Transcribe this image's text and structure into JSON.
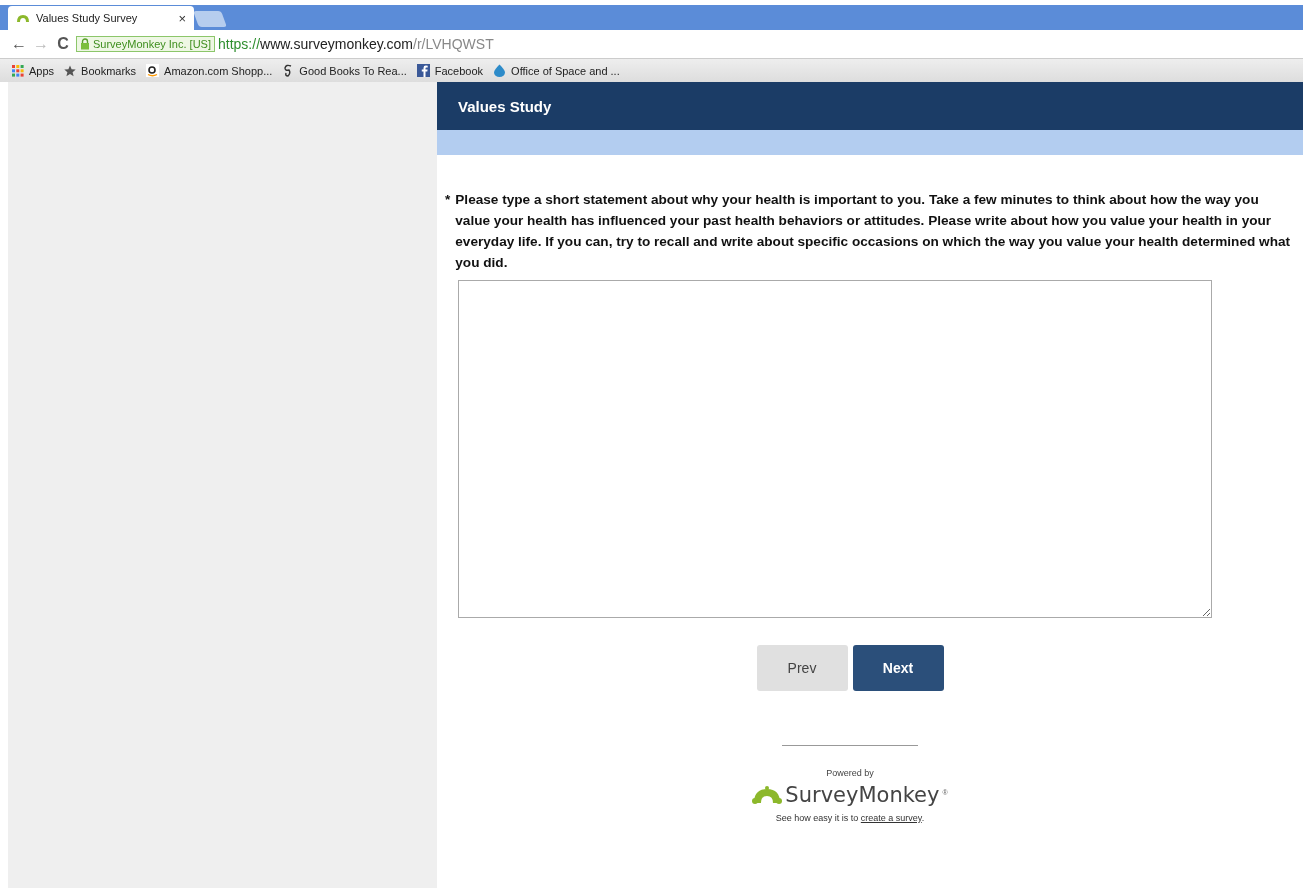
{
  "browser": {
    "tabs": [
      {
        "title": "Values Study Survey",
        "close": "×",
        "selected": true
      }
    ],
    "nav": {
      "back": "←",
      "forward": "→",
      "reload": "C"
    },
    "omnibox": {
      "identity": "SurveyMonkey Inc. [US]",
      "scheme": "https://",
      "host": "www.surveymonkey.com",
      "path": "/r/LVHQWST"
    },
    "bookmarks": [
      {
        "kind": "apps",
        "label": "Apps"
      },
      {
        "kind": "star",
        "label": "Bookmarks"
      },
      {
        "kind": "amazon",
        "label": "Amazon.com Shopp..."
      },
      {
        "kind": "goodbooks",
        "label": "Good Books To Rea..."
      },
      {
        "kind": "facebook",
        "label": "Facebook"
      },
      {
        "kind": "drop",
        "label": "Office of Space and ..."
      }
    ]
  },
  "survey": {
    "title": "Values Study",
    "question": {
      "required_mark": "*",
      "text": "Please type a short statement about why your health is important to you. Take a few minutes to think about how the way you value your health has influenced your past health behaviors or attitudes. Please write about how you value your health in your everyday life. If you can, try to recall and write about specific occasions on which the way you value your health determined what you did."
    },
    "buttons": [
      {
        "label": "Prev",
        "kind": "secondary"
      },
      {
        "label": "Next",
        "kind": "primary"
      }
    ],
    "footer": {
      "powered_by": "Powered by",
      "brand": "SurveyMonkey",
      "registered": "®",
      "pitch": "See how easy it is to ",
      "link": "create a survey",
      "end": "."
    }
  }
}
